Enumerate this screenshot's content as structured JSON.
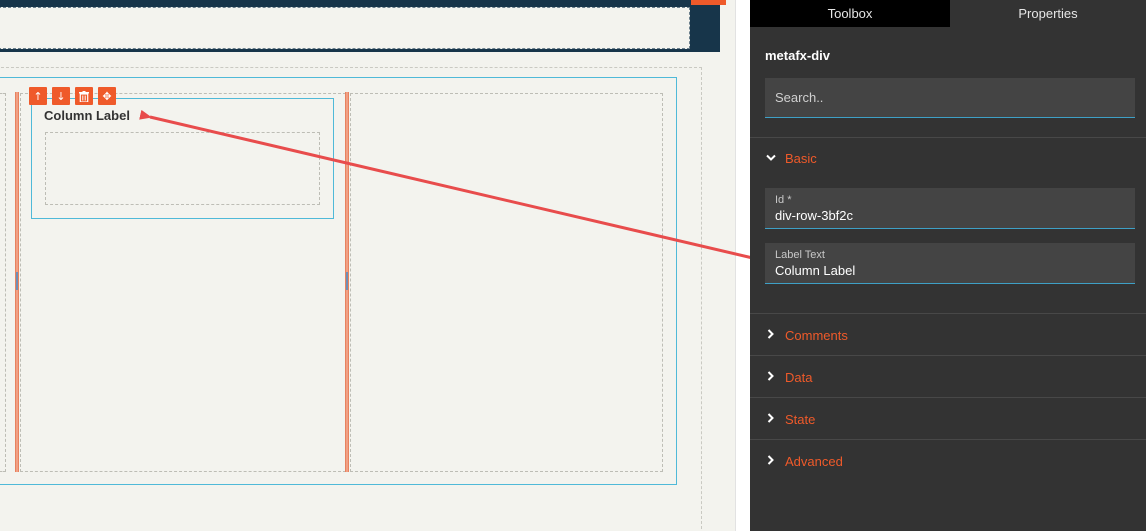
{
  "canvas": {
    "column_label": "Column Label",
    "tools": [
      {
        "icon": "arrow-up-icon",
        "glyph": "↑"
      },
      {
        "icon": "arrow-down-icon",
        "glyph": "↓"
      },
      {
        "icon": "trash-icon",
        "glyph": "🗑"
      },
      {
        "icon": "move-icon",
        "glyph": "✥"
      }
    ],
    "accent_color": "#ef5a2a",
    "selection_color": "#4fb9d8"
  },
  "panel": {
    "tabs": {
      "toolbox": "Toolbox",
      "properties": "Properties"
    },
    "component_name": "metafx-div",
    "search_placeholder": "Search..",
    "sections": {
      "basic": "Basic",
      "comments": "Comments",
      "data": "Data",
      "state": "State",
      "advanced": "Advanced"
    },
    "fields": {
      "id_label": "Id *",
      "id_value": "div-row-3bf2c",
      "label_text_label": "Label Text",
      "label_text_value": "Column Label"
    }
  }
}
